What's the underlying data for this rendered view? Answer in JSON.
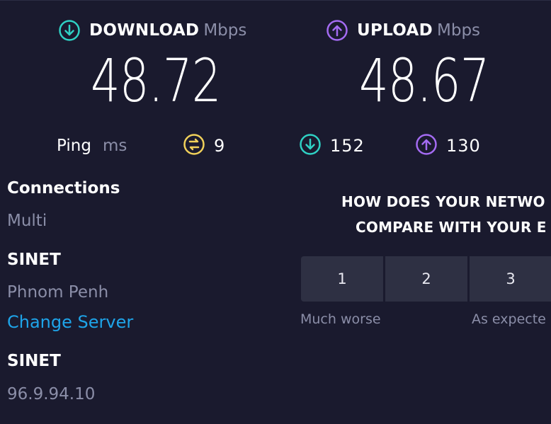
{
  "download": {
    "label": "DOWNLOAD",
    "unit": "Mbps",
    "value": "48.72",
    "icon": "download-arrow-icon",
    "color": "#2fd1c4"
  },
  "upload": {
    "label": "UPLOAD",
    "unit": "Mbps",
    "value": "48.67",
    "icon": "upload-arrow-icon",
    "color": "#a46bf2"
  },
  "ping": {
    "label": "Ping",
    "unit": "ms",
    "idle": {
      "value": "9",
      "icon": "ping-idle-icon",
      "color": "#f0d05a"
    },
    "download": {
      "value": "152",
      "icon": "download-arrow-icon",
      "color": "#2fd1c4"
    },
    "upload": {
      "value": "130",
      "icon": "upload-arrow-icon",
      "color": "#a46bf2"
    }
  },
  "connections": {
    "title": "Connections",
    "value": "Multi"
  },
  "server": {
    "name": "SINET",
    "location": "Phnom Penh",
    "change_link": "Change Server"
  },
  "client": {
    "isp": "SINET",
    "ip": "96.9.94.10"
  },
  "survey": {
    "line1": "HOW DOES YOUR NETWO",
    "line2": "COMPARE WITH YOUR E",
    "options": [
      "1",
      "2",
      "3"
    ],
    "caption_low": "Much worse",
    "caption_mid": "As expecte"
  }
}
